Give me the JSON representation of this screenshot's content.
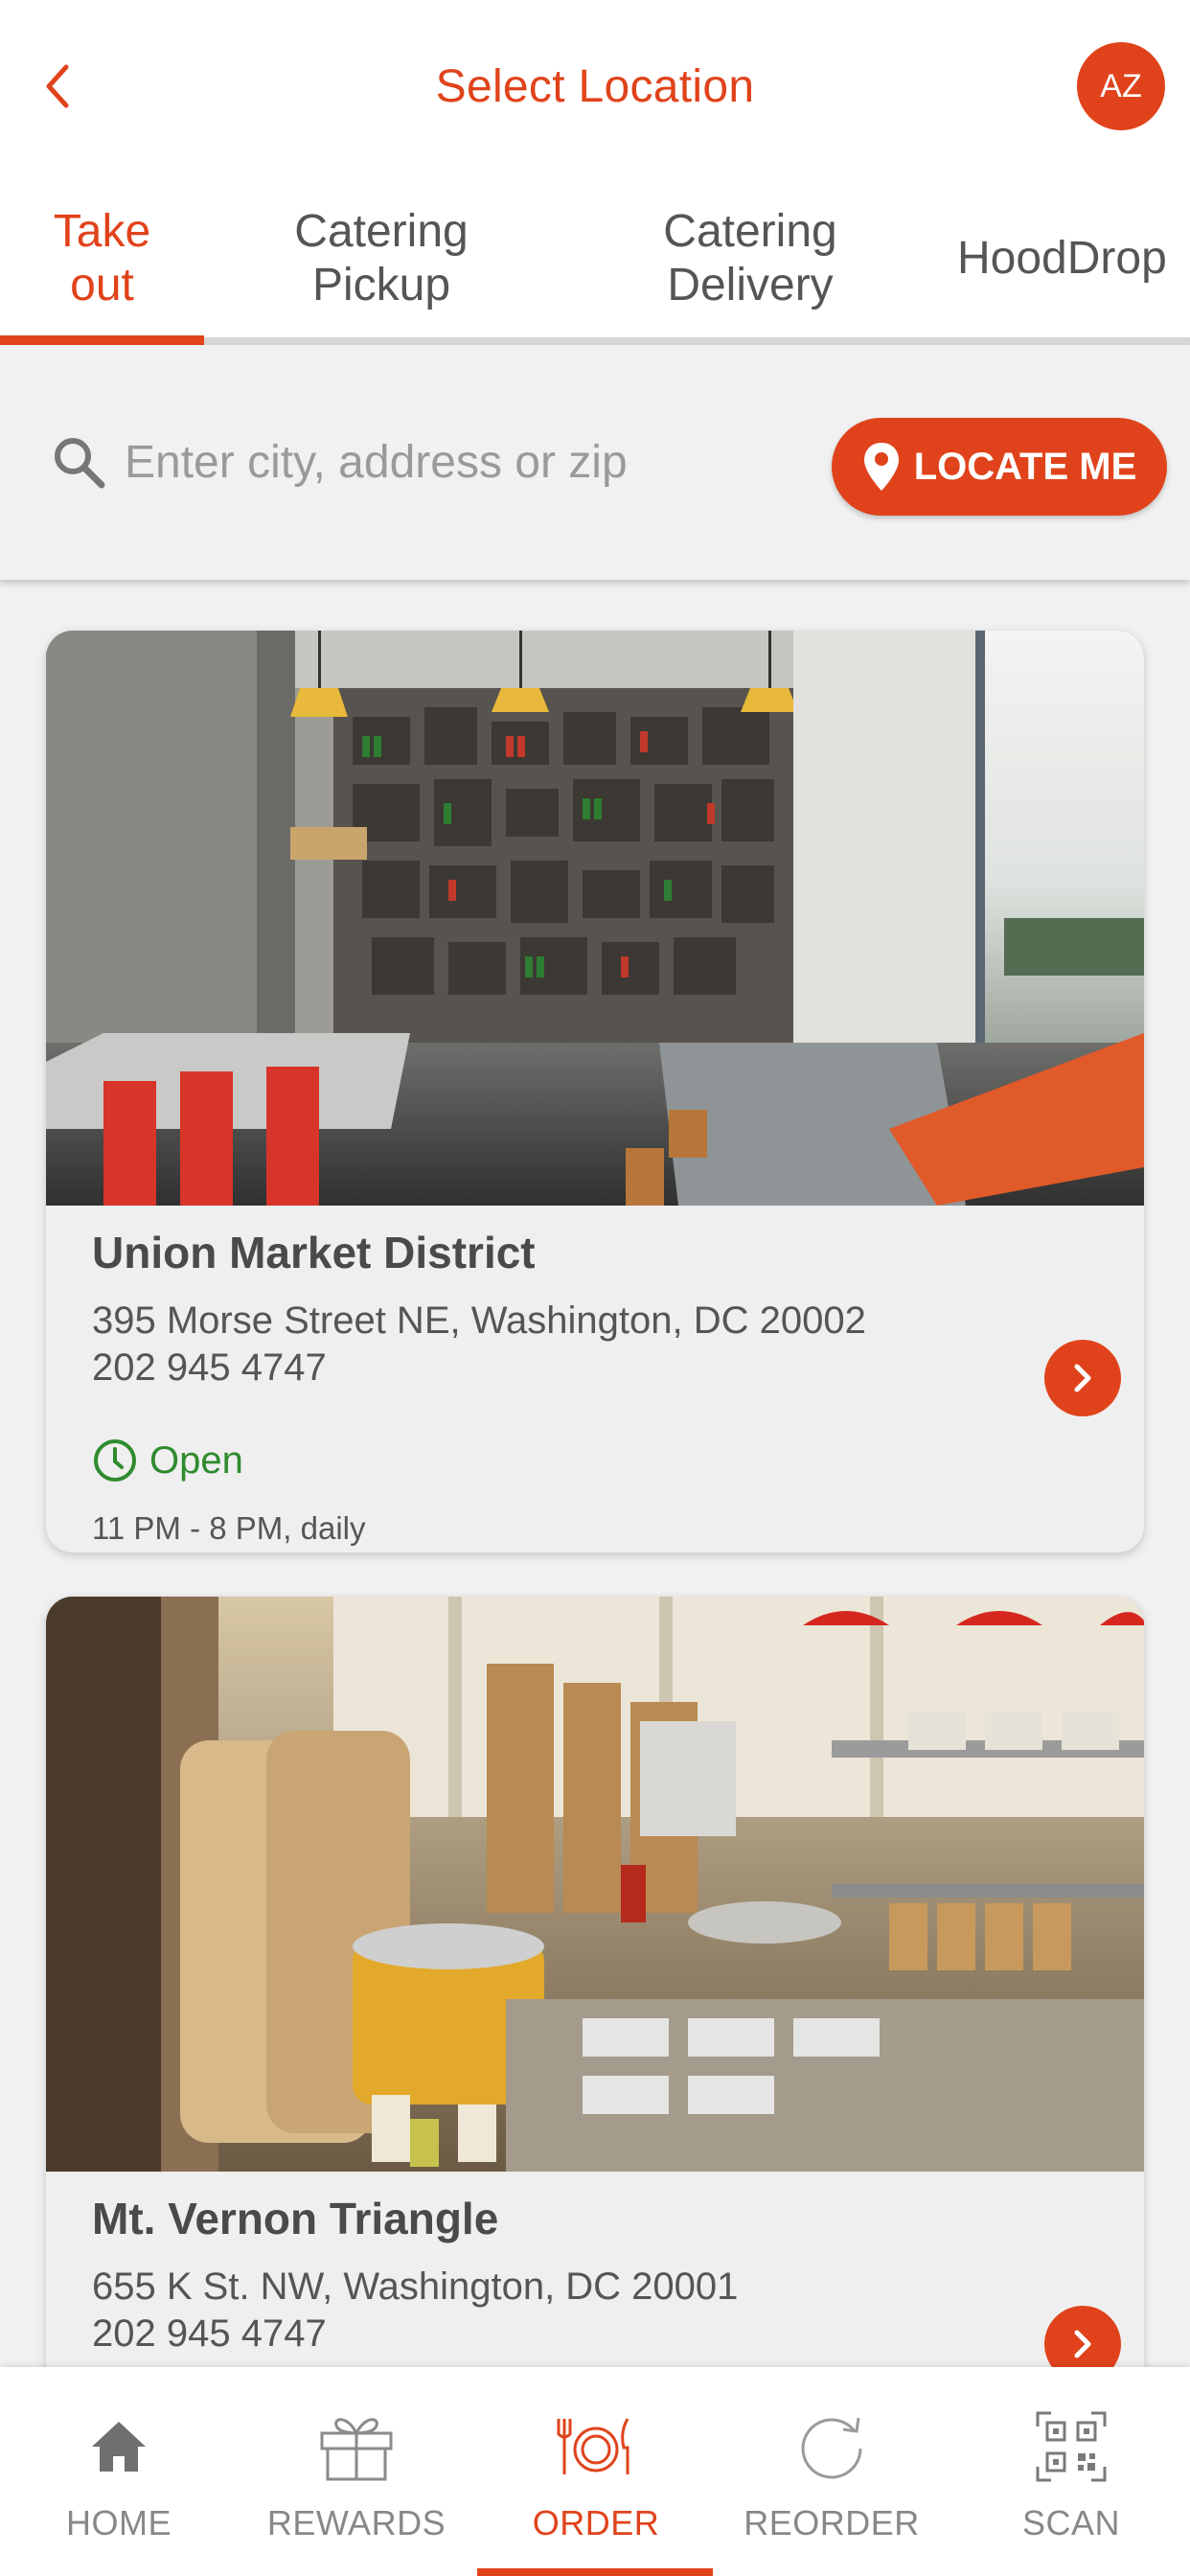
{
  "header": {
    "title": "Select Location",
    "avatar_initials": "AZ"
  },
  "tabs": [
    {
      "label": "Take out",
      "active": true
    },
    {
      "label": "Catering Pickup",
      "active": false
    },
    {
      "label": "Catering Delivery",
      "active": false
    },
    {
      "label": "HoodDrop",
      "active": false
    }
  ],
  "search": {
    "placeholder": "Enter city, address or zip",
    "value": "",
    "locate_label": "LOCATE ME"
  },
  "locations": [
    {
      "name": "Union Market District",
      "address": "395 Morse Street NE, Washington, DC 20002",
      "phone": "202 945 4747",
      "status": "Open",
      "hours": "11 PM - 8 PM, daily"
    },
    {
      "name": "Mt. Vernon Triangle",
      "address": "655 K St. NW, Washington, DC 20001",
      "phone": "202 945 4747"
    }
  ],
  "bottom_nav": [
    {
      "label": "HOME",
      "icon": "home-icon",
      "active": false
    },
    {
      "label": "REWARDS",
      "icon": "gift-icon",
      "active": false
    },
    {
      "label": "ORDER",
      "icon": "plate-cutlery-icon",
      "active": true
    },
    {
      "label": "REORDER",
      "icon": "refresh-icon",
      "active": false
    },
    {
      "label": "SCAN",
      "icon": "qr-code-icon",
      "active": false
    }
  ],
  "colors": {
    "accent": "#e0431b",
    "open_status": "#2e8b2e",
    "background": "#f1f1f1"
  }
}
